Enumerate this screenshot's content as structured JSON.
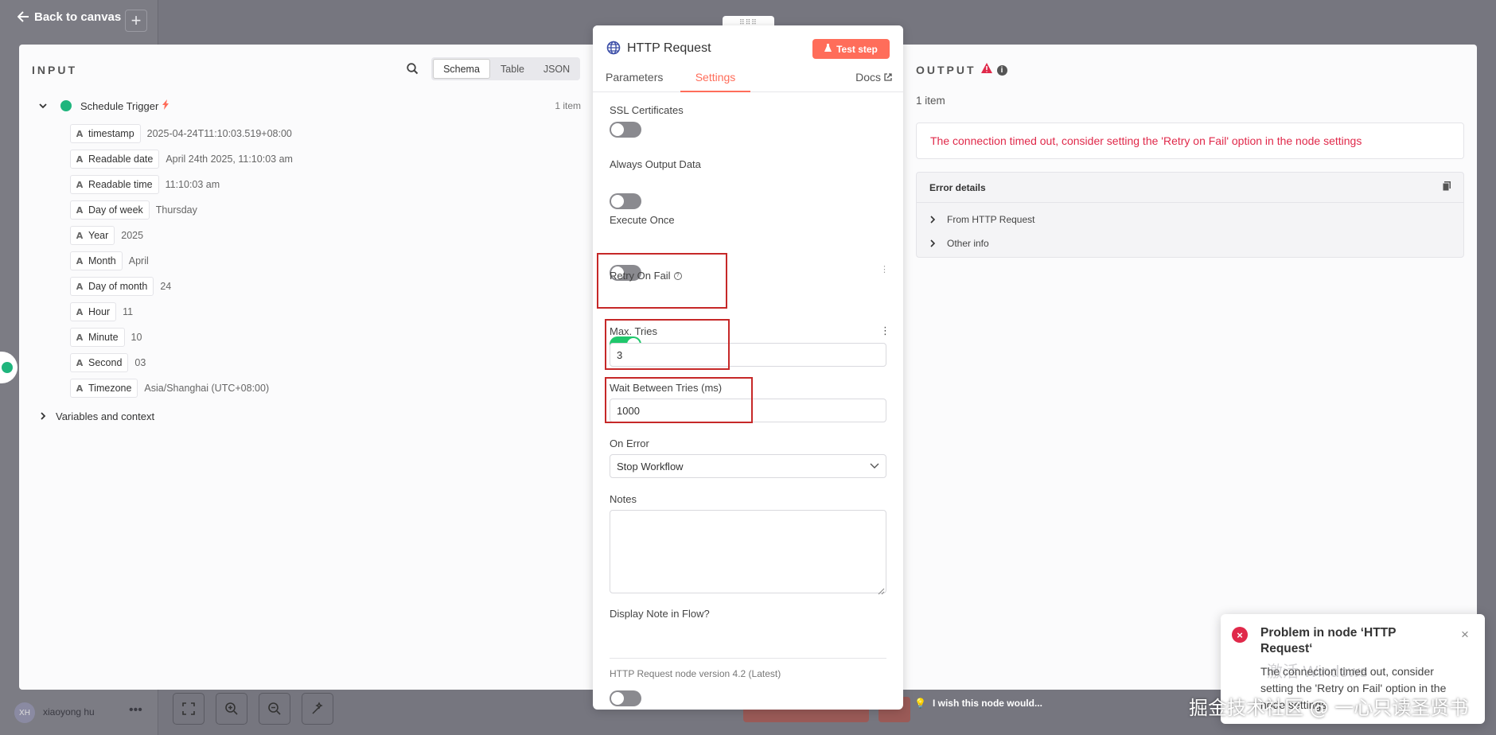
{
  "background": {
    "back_to_canvas": "Back to canvas",
    "user_initials": "XH",
    "user_name": "xiaoyong hu",
    "feedback_text": "I wish this node would...",
    "watermark": "掘金技术社区 @ 一心只读圣贤书",
    "windows_hint": "激活 Windows"
  },
  "input": {
    "heading": "INPUT",
    "view_tabs": [
      "Schema",
      "Table",
      "JSON"
    ],
    "trigger_name": "Schedule Trigger",
    "item_count": "1 item",
    "fields": [
      {
        "type": "A",
        "key": "timestamp",
        "value": "2025-04-24T11:10:03.519+08:00"
      },
      {
        "type": "A",
        "key": "Readable date",
        "value": "April 24th 2025, 11:10:03 am"
      },
      {
        "type": "A",
        "key": "Readable time",
        "value": "11:10:03 am"
      },
      {
        "type": "A",
        "key": "Day of week",
        "value": "Thursday"
      },
      {
        "type": "A",
        "key": "Year",
        "value": "2025"
      },
      {
        "type": "A",
        "key": "Month",
        "value": "April"
      },
      {
        "type": "A",
        "key": "Day of month",
        "value": "24"
      },
      {
        "type": "A",
        "key": "Hour",
        "value": "11"
      },
      {
        "type": "A",
        "key": "Minute",
        "value": "10"
      },
      {
        "type": "A",
        "key": "Second",
        "value": "03"
      },
      {
        "type": "A",
        "key": "Timezone",
        "value": "Asia/Shanghai (UTC+08:00)"
      }
    ],
    "variables_label": "Variables and context"
  },
  "node": {
    "title": "HTTP Request",
    "test_step": "Test step",
    "tabs": [
      "Parameters",
      "Settings"
    ],
    "docs": "Docs",
    "ssl_label": "SSL Certificates",
    "always_output_label": "Always Output Data",
    "execute_once_label": "Execute Once",
    "retry_label": "Retry On Fail",
    "max_tries_label": "Max. Tries",
    "max_tries_value": "3",
    "wait_label": "Wait Between Tries (ms)",
    "wait_value": "1000",
    "on_error_label": "On Error",
    "on_error_value": "Stop Workflow",
    "notes_label": "Notes",
    "notes_value": "",
    "display_note_label": "Display Note in Flow?",
    "version": "HTTP Request node version 4.2 (Latest)",
    "toggles": {
      "ssl": false,
      "always_output": false,
      "execute_once": false,
      "retry": true,
      "display_note": false
    }
  },
  "output": {
    "heading": "OUTPUT",
    "item_count": "1 item",
    "error_message": "The connection timed out, consider setting the 'Retry on Fail' option in the node settings",
    "error_details_label": "Error details",
    "details": [
      "From HTTP Request",
      "Other info"
    ]
  },
  "toast": {
    "title": "Problem in node ‘HTTP Request‘",
    "message": "The connection timed out, consider setting the 'Retry on Fail' option in the node settings"
  },
  "colors": {
    "accent": "#ff6d5a",
    "error": "#e0294a",
    "success": "#1fc76b",
    "highlight_box": "#c62828"
  }
}
